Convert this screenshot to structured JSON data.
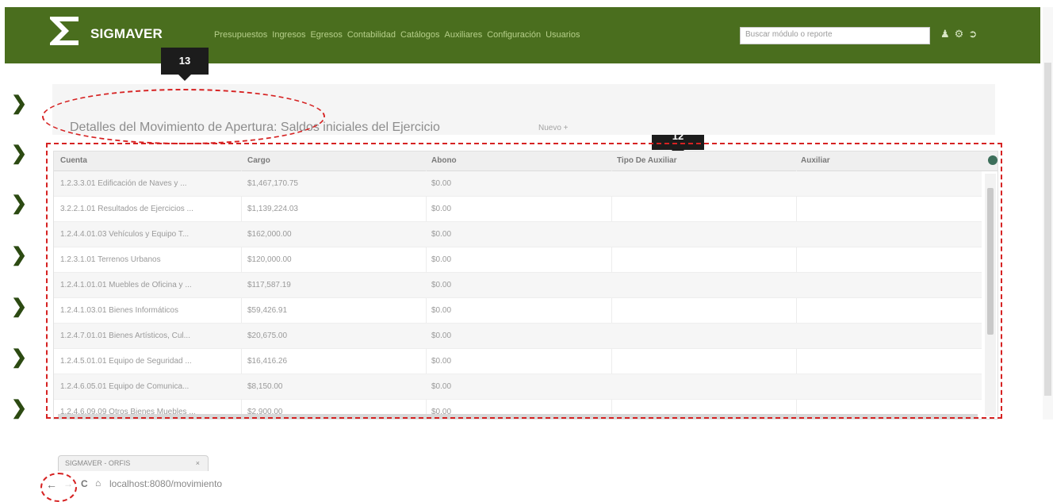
{
  "header": {
    "brand": "SIGMAVER",
    "nav": [
      "Presupuestos",
      "Ingresos",
      "Egresos",
      "Contabilidad",
      "Catálogos",
      "Auxiliares",
      "Configuración",
      "Usuarios"
    ],
    "search_placeholder": "Buscar módulo o reporte",
    "icons": [
      "user-icon",
      "settings-icon",
      "logout-icon"
    ]
  },
  "callouts": {
    "c13": "13",
    "c12": "12"
  },
  "page": {
    "title": "Detalles del Movimiento de Apertura: Saldos iniciales del Ejercicio",
    "new_label": "Nuevo +"
  },
  "grid": {
    "columns": [
      "Cuenta",
      "Cargo",
      "Abono",
      "Tipo De Auxiliar",
      "Auxiliar"
    ],
    "rows": [
      [
        "1.2.3.3.01 Edificación de Naves y ...",
        "$1,467,170.75",
        "$0.00",
        "",
        ""
      ],
      [
        "3.2.2.1.01 Resultados de Ejercicios ...",
        "$1,139,224.03",
        "$0.00",
        "",
        ""
      ],
      [
        "1.2.4.4.01.03 Vehículos y Equipo T...",
        "$162,000.00",
        "$0.00",
        "",
        ""
      ],
      [
        "1.2.3.1.01 Terrenos Urbanos",
        "$120,000.00",
        "$0.00",
        "",
        ""
      ],
      [
        "1.2.4.1.01.01 Muebles de Oficina y ...",
        "$117,587.19",
        "$0.00",
        "",
        ""
      ],
      [
        "1.2.4.1.03.01 Bienes Informáticos",
        "$59,426.91",
        "$0.00",
        "",
        ""
      ],
      [
        "1.2.4.7.01.01 Bienes Artísticos, Cul...",
        "$20,675.00",
        "$0.00",
        "",
        ""
      ],
      [
        "1.2.4.5.01.01 Equipo de Seguridad ...",
        "$16,416.26",
        "$0.00",
        "",
        ""
      ],
      [
        "1.2.4.6.05.01 Equipo de Comunica...",
        "$8,150.00",
        "$0.00",
        "",
        ""
      ],
      [
        "1.2.4.6.09.09 Otros Bienes Muebles ...",
        "$2,900.00",
        "$0.00",
        "",
        ""
      ]
    ]
  },
  "browser": {
    "tab_title": "SIGMAVER - ORFIS",
    "tab_close": "×",
    "back": "←",
    "forward": "→",
    "reload": "C",
    "home": "⌂",
    "url": "localhost:8080/movimiento"
  },
  "colors": {
    "header_bg": "#4a6e1e",
    "annotation": "#d62222",
    "chevron": "#2c4a12"
  }
}
